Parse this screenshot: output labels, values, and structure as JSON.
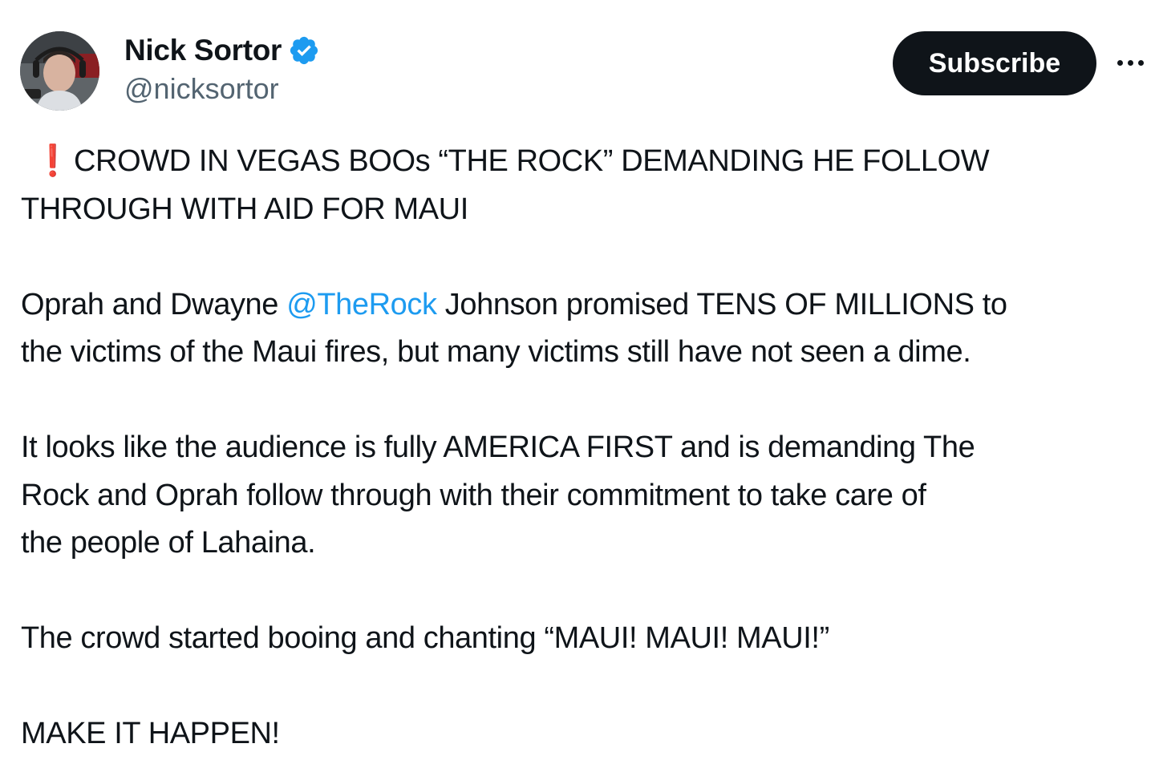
{
  "author": {
    "display_name": "Nick Sortor",
    "handle": "@nicksortor",
    "verified_icon": "verified-badge-icon",
    "avatar_icon": "avatar-photo"
  },
  "actions": {
    "subscribe_label": "Subscribe",
    "more_icon": "more-options-icon"
  },
  "tweet": {
    "p1": {
      "icon": "exclamation-icon",
      "icon_glyph": "❗",
      "line1": "CROWD IN VEGAS BOOs “THE ROCK” DEMANDING HE FOLLOW",
      "line2": "THROUGH WITH AID FOR MAUI"
    },
    "p2": {
      "line1_pre": "Oprah and Dwayne ",
      "mention": "@TheRock",
      "line1_post": " Johnson promised TENS OF MILLIONS to",
      "line2": "the victims of the Maui fires, but many victims still have not seen a dime."
    },
    "p3": {
      "line1": "It looks like the audience is fully AMERICA FIRST and is demanding The",
      "line2": "Rock and Oprah follow through with their commitment to take care of",
      "line3": "the people of Lahaina."
    },
    "p4": {
      "line1": "The crowd started booing and chanting “MAUI! MAUI! MAUI!”"
    },
    "p5": {
      "line1": "MAKE IT HAPPEN!"
    }
  },
  "colors": {
    "text": "#0f1419",
    "secondary": "#536471",
    "link": "#1d9bf0",
    "button_bg": "#0f1419",
    "verified": "#1d9bf0",
    "exclamation": "#e0245e"
  }
}
